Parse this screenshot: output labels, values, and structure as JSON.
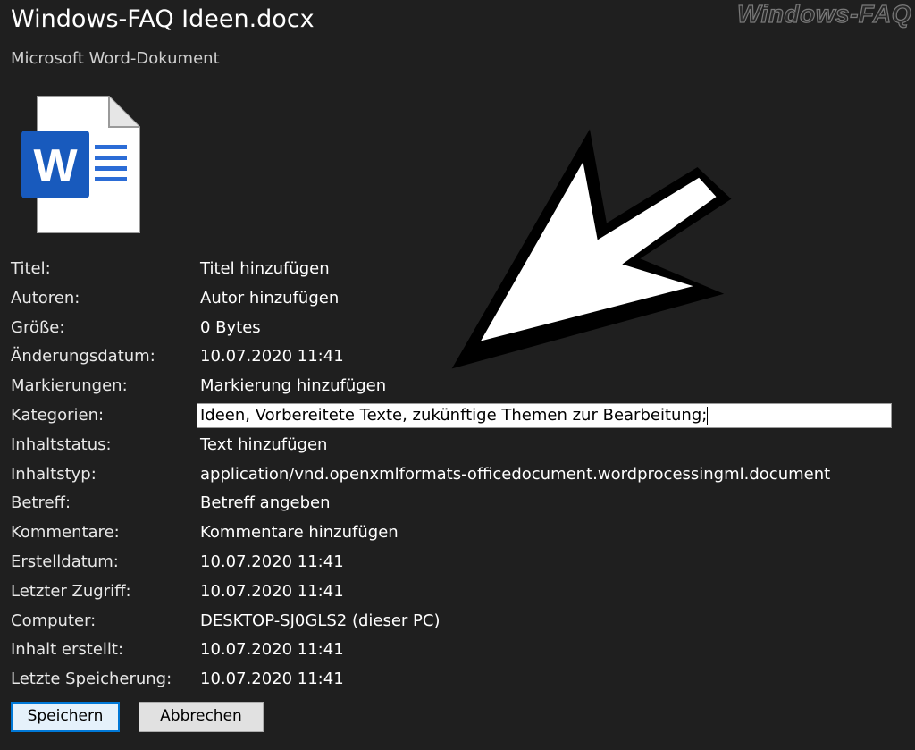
{
  "header": {
    "title": "Windows-FAQ Ideen.docx",
    "subtitle": "Microsoft Word-Dokument",
    "watermark": "Windows-FAQ"
  },
  "icon": {
    "name": "word-document-icon",
    "letter": "W",
    "brand_color": "#185abd"
  },
  "properties": [
    {
      "label": "Titel:",
      "value": "Titel hinzufügen"
    },
    {
      "label": "Autoren:",
      "value": "Autor hinzufügen"
    },
    {
      "label": "Größe:",
      "value": "0 Bytes"
    },
    {
      "label": "Änderungsdatum:",
      "value": "10.07.2020 11:41"
    },
    {
      "label": "Markierungen:",
      "value": "Markierung hinzufügen"
    },
    {
      "label": "Kategorien:",
      "value": "Ideen, Vorbereitete Texte, zukünftige Themen zur Bearbeitung;",
      "editing": true
    },
    {
      "label": "Inhaltstatus:",
      "value": "Text hinzufügen"
    },
    {
      "label": "Inhaltstyp:",
      "value": "application/vnd.openxmlformats-officedocument.wordprocessingml.document"
    },
    {
      "label": "Betreff:",
      "value": "Betreff angeben"
    },
    {
      "label": "Kommentare:",
      "value": "Kommentare hinzufügen"
    },
    {
      "label": "Erstelldatum:",
      "value": "10.07.2020 11:41"
    },
    {
      "label": "Letzter Zugriff:",
      "value": "10.07.2020 11:41"
    },
    {
      "label": "Computer:",
      "value": "DESKTOP-SJ0GLS2 (dieser PC)"
    },
    {
      "label": "Inhalt erstellt:",
      "value": "10.07.2020 11:41"
    },
    {
      "label": "Letzte Speicherung:",
      "value": "10.07.2020 11:41"
    }
  ],
  "buttons": {
    "save_label": "Speichern",
    "cancel_label": "Abbrechen"
  },
  "colors": {
    "background": "#1f1f1f",
    "accent": "#0078d7"
  }
}
